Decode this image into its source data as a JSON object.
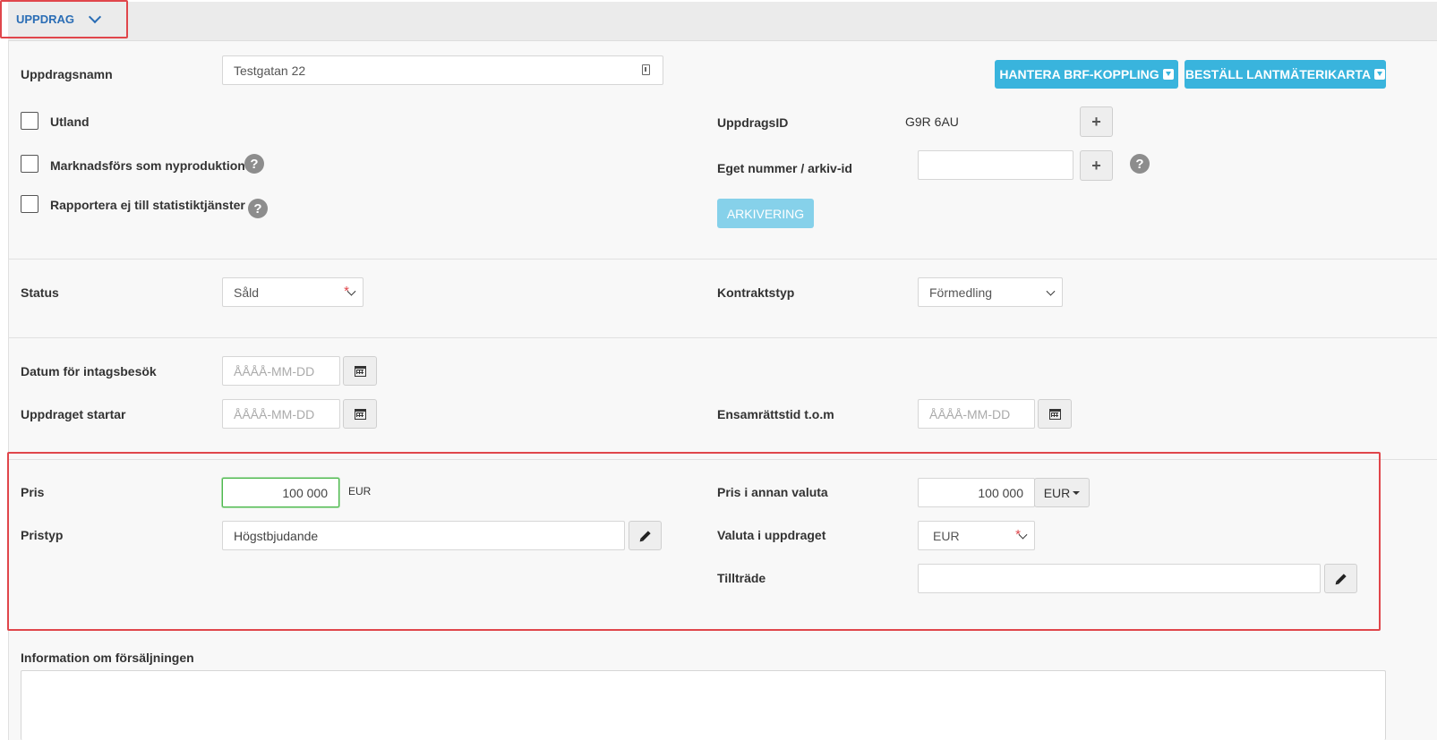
{
  "header": {
    "tab_label": "UPPDRAG",
    "chevron_icon": "chevron-down-icon"
  },
  "section_main": {
    "uppdragsnamn_label": "Uppdragsnamn",
    "uppdragsnamn_value": "Testgatan 22",
    "btn_brf": "HANTERA BRF-KOPPLING",
    "btn_lantmateri": "BESTÄLL LANTMÄTERIKARTA",
    "utland_label": "Utland",
    "nyproduktion_label": "Marknadsförs som nyproduktion",
    "rapportera_label": "Rapportera ej till statistiktjänster",
    "uppdragsid_label": "UppdragsID",
    "uppdragsid_value": "G9R 6AU",
    "eget_nummer_label": "Eget nummer / arkiv-id",
    "eget_nummer_value": "",
    "arkivering_label": "ARKIVERING"
  },
  "section_status": {
    "status_label": "Status",
    "status_value": "Såld",
    "kontraktstyp_label": "Kontraktstyp",
    "kontraktstyp_value": "Förmedling"
  },
  "section_dates": {
    "intagsbesok_label": "Datum för intagsbesök",
    "startar_label": "Uppdraget startar",
    "ensamratt_label": "Ensamrättstid t.o.m",
    "date_placeholder": "ÅÅÅÅ-MM-DD"
  },
  "section_price": {
    "pris_label": "Pris",
    "pris_value": "100 000",
    "pris_currency": "EUR",
    "pristyp_label": "Pristyp",
    "pristyp_value": "Högstbjudande",
    "annan_valuta_label": "Pris i annan valuta",
    "annan_valuta_value": "100 000",
    "annan_valuta_currency": "EUR",
    "valuta_label": "Valuta i uppdraget",
    "valuta_value": "EUR",
    "tilltrade_label": "Tillträde",
    "tilltrade_value": ""
  },
  "section_info": {
    "info_label": "Information om försäljningen",
    "info_value": ""
  },
  "colors": {
    "accent_blue": "#39b4dd",
    "highlight_red": "#e0464b",
    "focus_green": "#4cb84c"
  }
}
